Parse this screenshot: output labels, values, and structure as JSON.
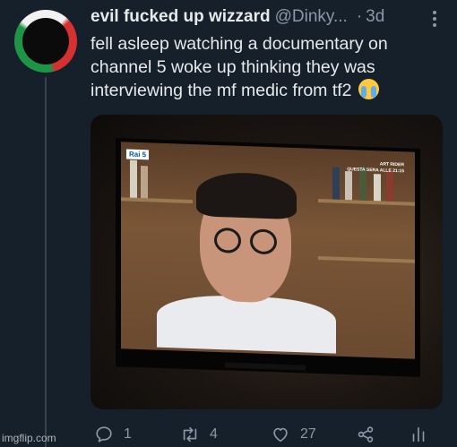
{
  "tweet": {
    "display_name": "evil fucked up wizzard",
    "handle": "@Dinky...",
    "separator": "·",
    "time": "3d",
    "text": "fell asleep watching a documentary on channel 5 woke up thinking they was interviewing the mf medic from tf2",
    "emoji": "loudly-crying-face"
  },
  "media": {
    "channel_logo": "Rai 5",
    "caption_lines": [
      "ART RIDER",
      "QUESTA SERA ALLE 21:15"
    ]
  },
  "actions": {
    "reply_count": "1",
    "retweet_count": "4",
    "like_count": "27"
  },
  "icons": {
    "reply": "speech-bubble-icon",
    "retweet": "retweet-arrows-icon",
    "like": "heart-icon",
    "share": "share-icon",
    "analytics": "bar-chart-icon",
    "more": "more-dots-icon"
  },
  "colors": {
    "background": "#15202b",
    "primary_text": "#e7e9ea",
    "secondary_text": "#8b98a5"
  },
  "watermark": "imgflip.com"
}
